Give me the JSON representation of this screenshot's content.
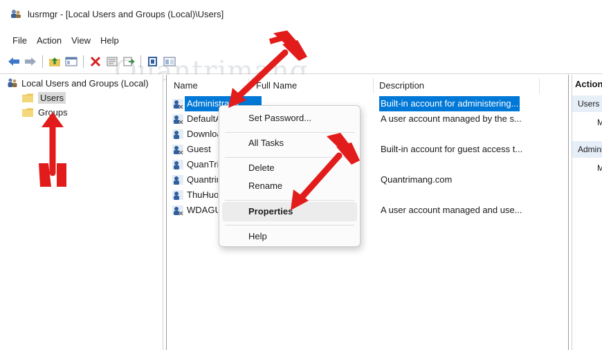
{
  "window": {
    "title": "lusrmgr - [Local Users and Groups (Local)\\Users]"
  },
  "menubar": {
    "items": [
      "File",
      "Action",
      "View",
      "Help"
    ]
  },
  "toolbar": {
    "buttons": [
      "back-icon",
      "forward-icon",
      "up-folder-icon",
      "show-hide-tree-icon",
      "delete-icon",
      "properties-icon",
      "export-list-icon",
      "help-icon",
      "console-view-icon"
    ]
  },
  "watermark": {
    "text": "Quantrimang"
  },
  "tree": {
    "root": "Local Users and Groups (Local)",
    "children": [
      {
        "label": "Users",
        "selected": true
      },
      {
        "label": "Groups",
        "selected": false
      }
    ]
  },
  "list": {
    "columns": [
      "Name",
      "Full Name",
      "Description"
    ],
    "rows": [
      {
        "name": "Administrator",
        "full_name": "",
        "description": "Built-in account for administering...",
        "selected": true
      },
      {
        "name": "DefaultAccount",
        "full_name": "",
        "description": "A user account managed by the s...",
        "selected": false
      },
      {
        "name": "Downloads",
        "full_name": "",
        "description": "",
        "selected": false
      },
      {
        "name": "Guest",
        "full_name": "",
        "description": "Built-in account for guest access t...",
        "selected": false
      },
      {
        "name": "QuanTri",
        "full_name": "",
        "description": "",
        "selected": false
      },
      {
        "name": "Quantrimang",
        "full_name": "",
        "description": "Quantrimang.com",
        "selected": false
      },
      {
        "name": "ThuHuong",
        "full_name": "",
        "description": "",
        "selected": false
      },
      {
        "name": "WDAGUtilityAccount",
        "full_name": "",
        "description": "A user account managed and use...",
        "selected": false
      }
    ]
  },
  "actions": {
    "title": "Actions",
    "sections": [
      "Users",
      "Administrator"
    ],
    "more": [
      "M",
      "M"
    ]
  },
  "context_menu": {
    "items": [
      "Set Password...",
      "All Tasks",
      "Delete",
      "Rename",
      "Properties",
      "Help"
    ],
    "submenu_arrow": "›"
  },
  "colors": {
    "selection": "#0078d7",
    "annotation_arrow": "#e21b1b"
  }
}
